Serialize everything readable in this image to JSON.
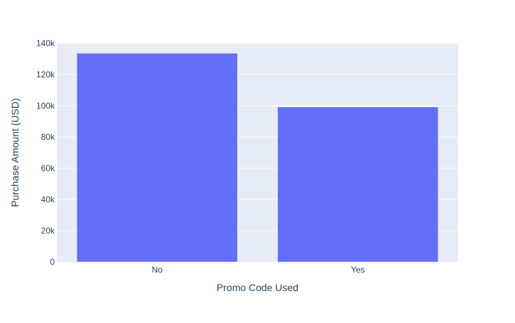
{
  "chart_data": {
    "type": "bar",
    "title": "",
    "categories": [
      "No",
      "Yes"
    ],
    "values": [
      133600,
      99200
    ],
    "xlabel": "Promo Code Used",
    "ylabel": "Purchase Amount (USD)",
    "ylim": [
      0,
      140000
    ],
    "yticks": [
      0,
      20000,
      40000,
      60000,
      80000,
      100000,
      120000,
      140000
    ],
    "ytick_labels": [
      "0",
      "20k",
      "40k",
      "60k",
      "80k",
      "100k",
      "120k",
      "140k"
    ],
    "grid": true,
    "bar_color": "#636efa",
    "plot_bg": "#e5ecf6"
  }
}
